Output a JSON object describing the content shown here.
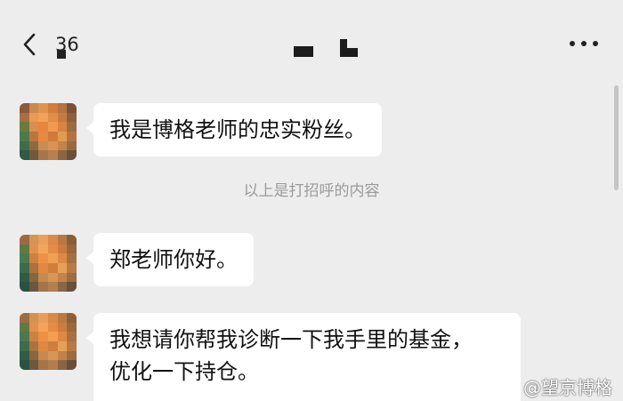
{
  "nav": {
    "unread_count": "36",
    "back_icon": "chevron-left-icon",
    "more_icon": "more-dots-icon"
  },
  "messages": [
    {
      "text": "我是博格老师的忠实粉丝。"
    },
    {
      "text": "郑老师你好。"
    },
    {
      "text_line1": "我想请你帮我诊断一下我手里的基金，",
      "text_line2": "优化一下持仓。"
    }
  ],
  "system_notice": "以上是打招呼的内容",
  "watermark": "@望京博格"
}
